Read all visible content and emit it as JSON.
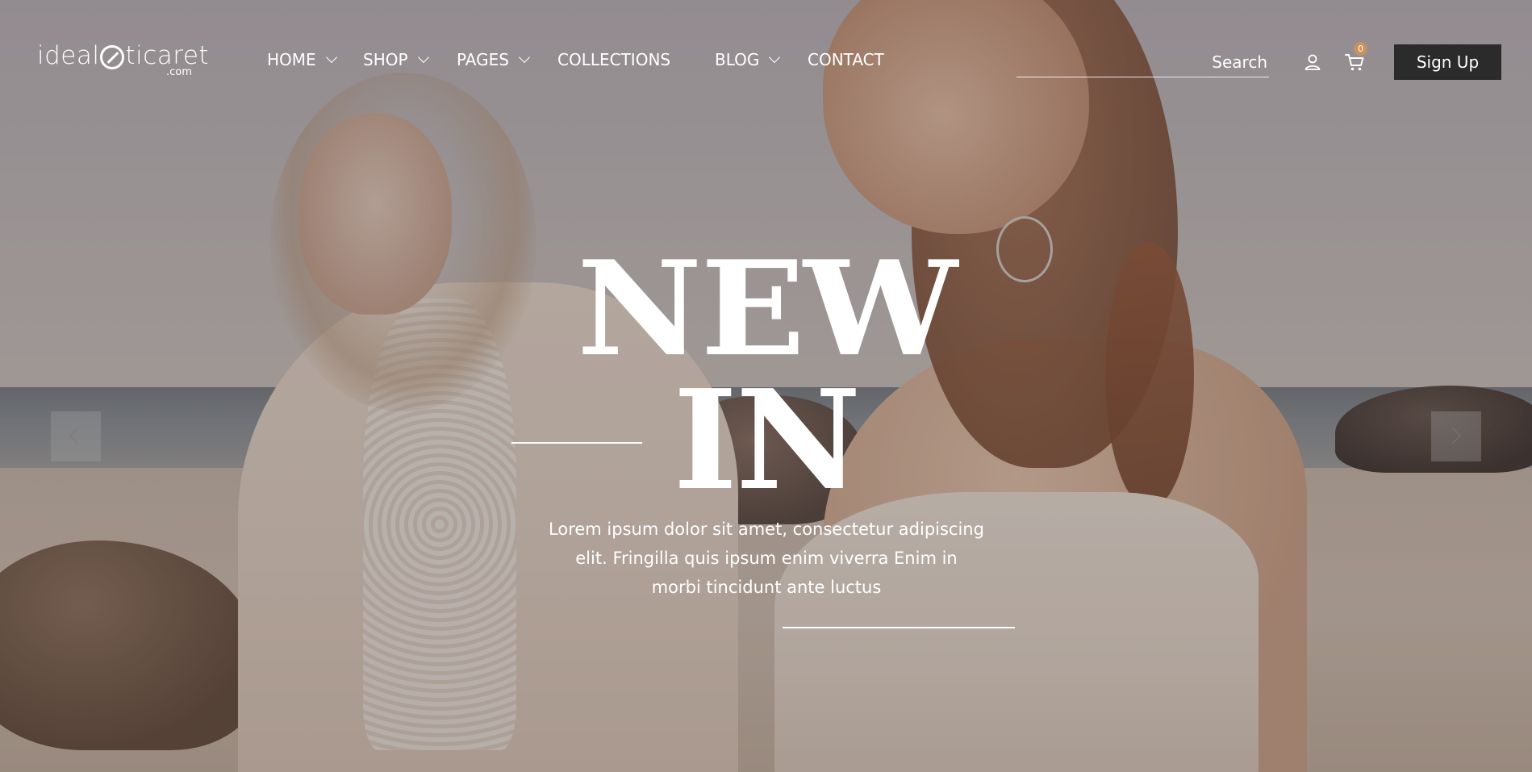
{
  "brand": {
    "logo_prefix": "ideal",
    "logo_suffix_text": "ticaret",
    "logo_domain": ".com",
    "mark_icon": "circle-slash-logo-mark"
  },
  "nav": {
    "items": [
      {
        "label": "HOME",
        "has_dropdown": true
      },
      {
        "label": "SHOP",
        "has_dropdown": true
      },
      {
        "label": "PAGES",
        "has_dropdown": true
      },
      {
        "label": "COLLECTIONS",
        "has_dropdown": false
      },
      {
        "label": "BLOG",
        "has_dropdown": true
      },
      {
        "label": "CONTACT",
        "has_dropdown": false
      }
    ]
  },
  "header": {
    "search_placeholder": "Search",
    "user_icon": "user-icon",
    "cart_icon": "cart-icon",
    "cart_count": "0",
    "signup_label": "Sign Up"
  },
  "hero": {
    "headline_line1": "NEW",
    "headline_line2": "IN",
    "description": "Lorem ipsum dolor sit amet, consectetur adipiscing elit. Fringilla quis ipsum enim viverra Enim in morbi tincidunt ante luctus",
    "prev_icon": "chevron-left-icon",
    "next_icon": "chevron-right-icon"
  },
  "colors": {
    "signup_bg": "#2b2b2b",
    "badge_bg": "#c9915d",
    "text": "#ffffff"
  }
}
